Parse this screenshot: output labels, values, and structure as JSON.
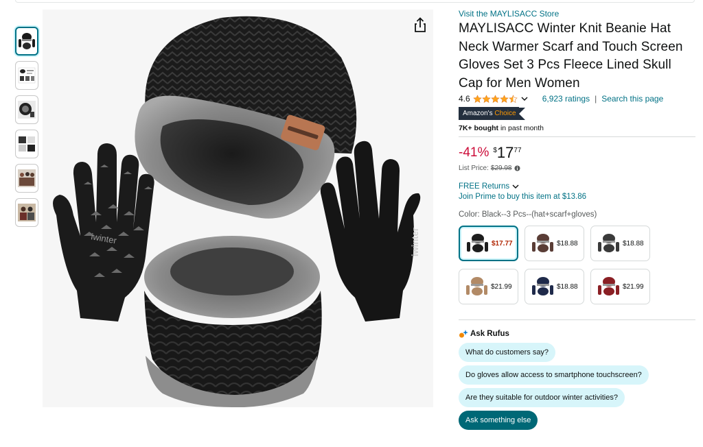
{
  "store": {
    "link_text": "Visit the MAYLISACC Store"
  },
  "product": {
    "title": "MAYLISACC Winter Knit Beanie Hat Neck Warmer Scarf and Touch Screen Gloves Set 3 Pcs Fleece Lined Skull Cap for Men Women",
    "brand_on_glove": "iwinter"
  },
  "rating": {
    "value": "4.6",
    "stars": 4.5,
    "count_text": "6,923 ratings",
    "search_link": "Search this page",
    "separator": "|"
  },
  "badge": {
    "part1": "Amazon's ",
    "part2": "Choice"
  },
  "bought": {
    "bold": "7K+ bought",
    "rest": " in past month"
  },
  "price": {
    "discount": "-41%",
    "symbol": "$",
    "whole": "17",
    "fraction": "77",
    "list_label": "List Price:",
    "list_value": "$29.98"
  },
  "delivery": {
    "free_returns": "FREE Returns",
    "prime_offer": "Join Prime to buy this item at $13.86"
  },
  "variant": {
    "label": "Color: Black--3 Pcs--(hat+scarf+gloves)",
    "options": [
      {
        "price": "$17.77",
        "color": "#1d1d1d",
        "selected": true
      },
      {
        "price": "$18.88",
        "color": "#5a3d36",
        "selected": false
      },
      {
        "price": "$18.88",
        "color": "#3a3a3a",
        "selected": false
      },
      {
        "price": "$21.99",
        "color": "#b28a66",
        "selected": false
      },
      {
        "price": "$18.88",
        "color": "#1f2a4a",
        "selected": false
      },
      {
        "price": "$21.99",
        "color": "#8a1f24",
        "selected": false
      }
    ]
  },
  "rufus": {
    "heading": "Ask Rufus",
    "questions": [
      "What do customers say?",
      "Do gloves allow access to smartphone touchscreen?",
      "Are they suitable for outdoor winter activities?"
    ],
    "ask_button": "Ask something else"
  },
  "colors": {
    "link": "#007185",
    "deal_red": "#cc0c39",
    "star": "#ffa41c",
    "badge_bg": "#232f3e",
    "badge_accent": "#ff9900",
    "chip_bg": "#d7f5fa",
    "chip_dark": "#006876"
  },
  "icons": {
    "share": "share-icon",
    "rating_dropdown": "chevron-down-icon",
    "info": "info-icon",
    "returns_dropdown": "chevron-down-icon",
    "rufus": "sparkle-icon"
  }
}
